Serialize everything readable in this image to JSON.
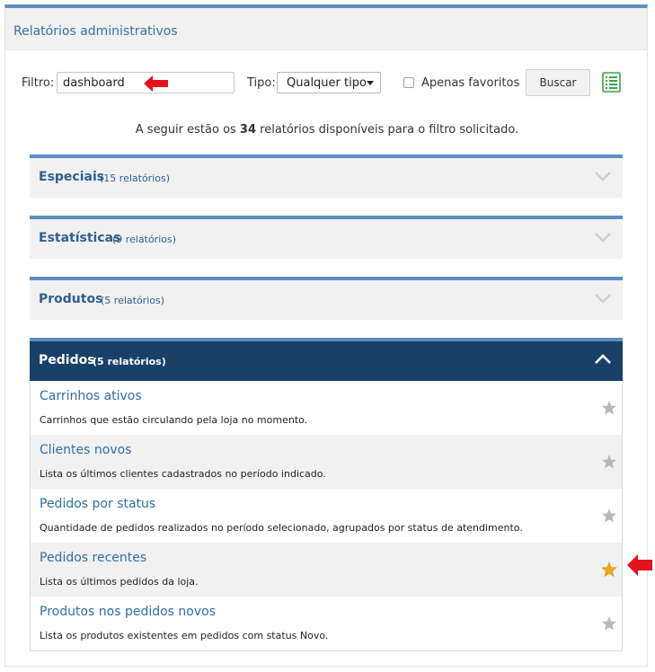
{
  "panel": {
    "title": "Relatórios administrativos"
  },
  "filters": {
    "filtro_label": "Filtro:",
    "filtro_value": "dashboard",
    "tipo_label": "Tipo:",
    "tipo_value": "Qualquer tipo",
    "favoritos_label": "Apenas favoritos",
    "favoritos_checked": false,
    "buscar_label": "Buscar",
    "list_icon": "list-view-icon"
  },
  "summary": {
    "prefix": "A seguir estão os ",
    "count": "34",
    "suffix": " relatórios disponíveis para o filtro solicitado."
  },
  "sections": [
    {
      "title": "Especiais",
      "count": "(15 relatórios)",
      "expanded": false
    },
    {
      "title": "Estatísticas",
      "count": "(9 relatórios)",
      "expanded": false
    },
    {
      "title": "Produtos",
      "count": "(5 relatórios)",
      "expanded": false
    },
    {
      "title": "Pedidos",
      "count": "(5 relatórios)",
      "expanded": true
    }
  ],
  "reports": [
    {
      "title": "Carrinhos ativos",
      "desc": "Carrinhos que estão circulando pela loja no momento.",
      "favorite": false
    },
    {
      "title": "Clientes novos",
      "desc": "Lista os últimos clientes cadastrados no período indicado.",
      "favorite": false
    },
    {
      "title": "Pedidos por status",
      "desc": "Quantidade de pedidos realizados no período selecionado, agrupados por status de atendimento.",
      "favorite": false
    },
    {
      "title": "Pedidos recentes",
      "desc": "Lista os últimos pedidos da loja.",
      "favorite": true
    },
    {
      "title": "Produtos nos pedidos novos",
      "desc": "Lista os produtos existentes em pedidos com status Novo.",
      "favorite": false
    }
  ],
  "colors": {
    "accent": "#5b8fbf",
    "header_dark": "#1a4068",
    "link": "#2f6ea5",
    "star_fav": "#f0a81e",
    "star_off": "#b8b8b8",
    "pointer_arrow": "#e3131b"
  }
}
